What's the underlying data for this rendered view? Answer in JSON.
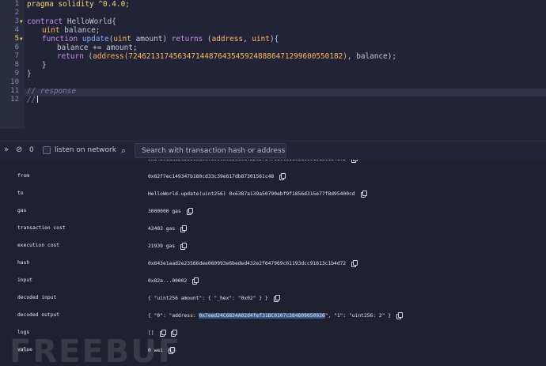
{
  "editor": {
    "line_numbers": [
      "1",
      "2",
      "3",
      "4",
      "5",
      "6",
      "7",
      "8",
      "9",
      "10",
      "11",
      "12"
    ],
    "active_line": "5",
    "lines": {
      "l1": {
        "kw": "pragma",
        "name": "solidity",
        "version": "^0.4.0;"
      },
      "l3": {
        "kw": "contract",
        "name": "HelloWorld{"
      },
      "l4": {
        "type": "uint",
        "name": "balance;"
      },
      "l5": {
        "kw": "function",
        "fn": "update",
        "p_open": "(",
        "type1": "uint",
        "p_name": " amount",
        "p_close": ")",
        "ret_kw": "returns",
        "ret_open": " (",
        "ret_t1": "address",
        "ret_sep": ", ",
        "ret_t2": "uint",
        "ret_close": "){"
      },
      "l6": {
        "text": "balance += amount;"
      },
      "l7": {
        "kw": "return",
        "open": " (",
        "fn": "address",
        "num": "(724621317456347144876435459248886471299600550182)",
        "rest": ", balance);"
      },
      "l8": {
        "text": "}"
      },
      "l9": {
        "text": "}"
      },
      "l11": {
        "comment": "// response"
      },
      "l12": {
        "comment": "//"
      }
    }
  },
  "toolbar": {
    "count": "0",
    "listen_label": "listen on network",
    "search_placeholder": "Search with transaction hash or address"
  },
  "tx": {
    "partial_hash": "0x643e1aad2e23566dee060993e6beded432e2f647969c61193dcc91613c1b4d72",
    "rows": [
      {
        "key": "from",
        "value": "0x82f7ec149347b180cd33c39e617db87301561c48"
      },
      {
        "key": "to",
        "value": "HelloWorld.update(uint256) 0x6387a139a50790ebf9f1856d315e77f8d95400cd"
      },
      {
        "key": "gas",
        "value": "3000000 gas"
      },
      {
        "key": "transaction cost",
        "value": "43403 gas"
      },
      {
        "key": "execution cost",
        "value": "21939 gas"
      },
      {
        "key": "hash",
        "value": "0x643e1aad2e23566dee060993e6beded432e2f647969c61193dcc91613c1b4d72"
      },
      {
        "key": "input",
        "value": "0x82a...00002"
      },
      {
        "key": "decoded input",
        "value": "{ \"uint256 amount\": { \"_hex\": \"0x02\" } }"
      },
      {
        "key": "logs",
        "value": "[]"
      },
      {
        "key": "value",
        "value": "0 wei"
      }
    ],
    "decoded_output": {
      "key": "decoded output",
      "prefix": "{ \"0\": \"address: ",
      "address": "0x7eed24C6834A02d4fef31BC0107c384809050926",
      "suffix": "\", \"1\": \"uint256: 2\" }"
    }
  },
  "watermark": "FREEBUF",
  "colors": {
    "background": "#222336",
    "gutter": "#2a2c3f",
    "active_line_number": "#ffd65c",
    "selection": "#3a5a8c"
  }
}
